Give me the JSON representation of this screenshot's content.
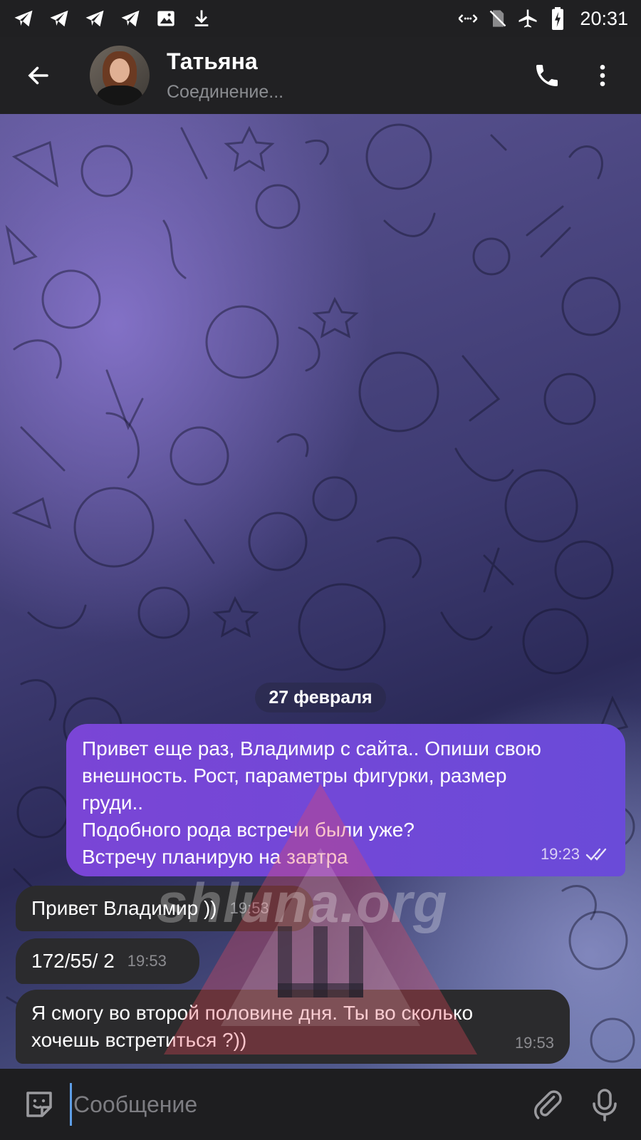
{
  "status_bar": {
    "time": "20:31",
    "notification_icons": [
      "telegram-icon",
      "telegram-icon",
      "telegram-icon",
      "telegram-icon",
      "image-icon",
      "download-icon"
    ],
    "system_icons": [
      "nfc-icon",
      "no-sim-icon",
      "airplane-icon",
      "battery-charging-icon"
    ]
  },
  "header": {
    "contact_name": "Татьяна",
    "connection_status": "Соединение..."
  },
  "chat": {
    "date_label": "27 февраля",
    "messages": [
      {
        "direction": "out",
        "text": "Привет еще раз, Владимир с сайта.. Опиши свою\nвнешность. Рост, параметры фигурки, размер\nгруди..\nПодобного рода встречи были уже?\nВстречу планирую на завтра",
        "time": "19:23",
        "read": true
      },
      {
        "direction": "in",
        "text": "Привет Владимир ))",
        "time": "19:53"
      },
      {
        "direction": "in",
        "text": "172/55/ 2",
        "time": "19:53"
      },
      {
        "direction": "in",
        "text": "Я  смогу во второй половине дня. Ты во сколько\nхочешь встретиться ?))",
        "time": "19:53"
      }
    ]
  },
  "watermark": {
    "text": "shluna.org",
    "letter": "Ш"
  },
  "composer": {
    "placeholder": "Сообщение"
  },
  "colors": {
    "outgoing_bubble": "#7a45d6",
    "incoming_bubble": "#2b2b2d",
    "header_bg": "#212123",
    "accent": "#5e9ee6"
  }
}
